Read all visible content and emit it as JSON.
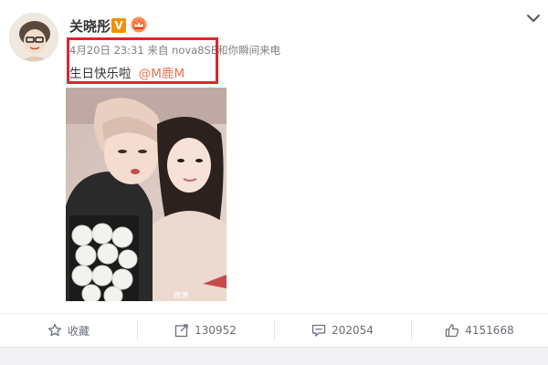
{
  "post": {
    "username": "关晓彤",
    "vip_badge": "V",
    "meta_text": "4月20日 23:31 来自 nova8SE和你瞬间来电",
    "text": "生日快乐啦",
    "mention": "@M鹿M",
    "photo_watermark": "微博"
  },
  "actions": [
    {
      "label": "收藏",
      "icon": "star-icon"
    },
    {
      "label": "130952",
      "icon": "share-icon"
    },
    {
      "label": "202054",
      "icon": "comment-icon"
    },
    {
      "label": "4151668",
      "icon": "like-icon"
    }
  ],
  "colors": {
    "mention": "#eb7350",
    "highlight": "#e3232c",
    "vip": "#f29100",
    "action_text": "#696e78"
  }
}
